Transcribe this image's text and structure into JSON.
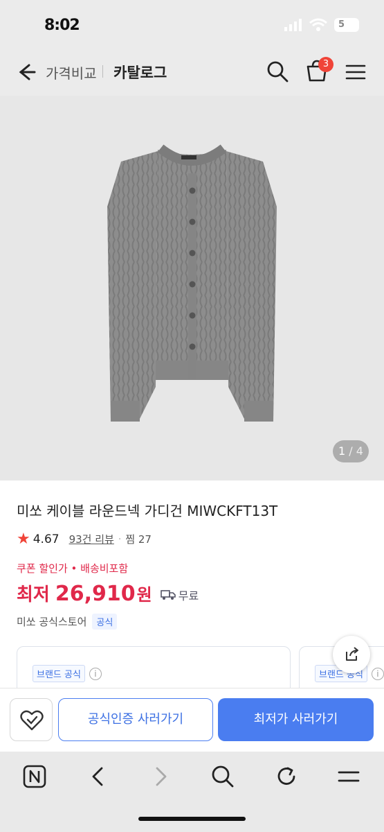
{
  "status_bar": {
    "time": "8:02",
    "battery": "5"
  },
  "header": {
    "title_compare": "가격비교",
    "title_catalog": "카탈로그",
    "cart_count": "3"
  },
  "gallery": {
    "current": "1",
    "separator": " / ",
    "total": "4"
  },
  "product": {
    "title": "미쏘 케이블 라운드넥 가디건 MIWCKFT13T",
    "rating": "4.67",
    "reviews": "93건 리뷰",
    "wish": "찜 27",
    "coupon_line": "쿠폰 할인가 • 배송비포함",
    "price_prefix": "최저",
    "price_value": "26,910",
    "price_unit": "원",
    "shipping": "무료",
    "store": "미쏘 공식스토어",
    "store_badge": "공식"
  },
  "cards": {
    "card1_tag": "브랜드 공식",
    "card2_tag": "브랜드 공식",
    "info_icon": "i"
  },
  "buy_bar": {
    "official_label": "공식인증 사러가기",
    "lowest_label": "최저가 사러가기"
  },
  "colors": {
    "accent_blue": "#4a7df0",
    "price_red": "#e0284a",
    "badge_red": "#f04438",
    "header_bg": "#ebebeb"
  },
  "icons": [
    "back-icon",
    "search-icon",
    "cart-icon",
    "menu-icon",
    "star-icon",
    "truck-icon",
    "share-icon",
    "heart-check-icon",
    "naver-home-icon",
    "chevron-left-icon",
    "chevron-right-icon",
    "refresh-icon"
  ]
}
